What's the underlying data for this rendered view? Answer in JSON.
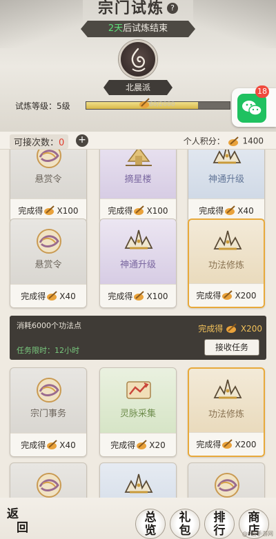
{
  "header": {
    "title": "宗门试炼",
    "help_icon": "question-mark-icon",
    "timer_number": "2天",
    "timer_suffix": "后试炼结束",
    "sect_name": "北晨派",
    "level_label": "试炼等级：5级",
    "level_progress_text": "1560/2000",
    "level_progress": 0.78
  },
  "wechat": {
    "badge": "18",
    "icon": "wechat-icon"
  },
  "status": {
    "attempts_label": "可接次数：",
    "attempts_value": "0",
    "plus_label": "+",
    "points_label": "个人积分：",
    "points_value": "1400"
  },
  "cards": [
    {
      "name": "悬赏令",
      "reward_label": "完成得",
      "reward_value": "X100",
      "style": "gray",
      "icon": "scroll-orb-icon"
    },
    {
      "name": "摘星楼",
      "reward_label": "完成得",
      "reward_value": "X100",
      "style": "purple",
      "icon": "tower-icon"
    },
    {
      "name": "神通升级",
      "reward_label": "完成得",
      "reward_value": "X40",
      "style": "blue",
      "icon": "crown-icon"
    },
    {
      "name": "悬赏令",
      "reward_label": "完成得",
      "reward_value": "X40",
      "style": "gray",
      "icon": "scroll-orb-icon"
    },
    {
      "name": "神通升级",
      "reward_label": "完成得",
      "reward_value": "X100",
      "style": "purple",
      "icon": "crown-icon"
    },
    {
      "name": "功法修炼",
      "reward_label": "完成得",
      "reward_value": "X200",
      "style": "gold",
      "icon": "crown-icon"
    },
    {
      "name": "宗门事务",
      "reward_label": "完成得",
      "reward_value": "X40",
      "style": "gray",
      "icon": "scroll-orb-icon"
    },
    {
      "name": "灵脉采集",
      "reward_label": "完成得",
      "reward_value": "X20",
      "style": "green",
      "icon": "scroll-map-icon"
    },
    {
      "name": "功法修炼",
      "reward_label": "完成得",
      "reward_value": "X200",
      "style": "gold",
      "icon": "crown-icon"
    }
  ],
  "task_panel": {
    "cost": "消耗6000个功法点",
    "time_label": "任务限时：",
    "time_value": "12小时",
    "reward_label": "完成得",
    "reward_value": "X200",
    "accept_button": "接收任务"
  },
  "footer": {
    "back_top": "返",
    "back_bottom": "回",
    "btn1_top": "总",
    "btn1_bottom": "览",
    "btn2_top": "礼",
    "btn2_bottom": "包",
    "btn3_top": "排",
    "btn3_bottom": "行",
    "btn4_top": "商",
    "btn4_bottom": "店",
    "watermark": "@9游手游网"
  },
  "colors": {
    "accent_gold": "#e8a93a",
    "panel_dark": "#3f3b36",
    "timer_green": "#5ee07a",
    "zero_red": "#e23b2c"
  }
}
